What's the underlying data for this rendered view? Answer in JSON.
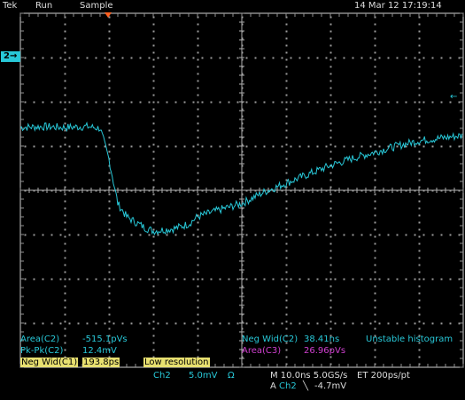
{
  "header": {
    "brand": "Tek",
    "run_state": "Run",
    "acq_mode": "Sample",
    "datetime": "14 Mar 12 17:19:14"
  },
  "channel_marker": "2",
  "ref_arrow": "←",
  "measurements": {
    "left": [
      {
        "label": "Area(C2)",
        "value": "-515.1pVs"
      },
      {
        "label": "Pk-Pk(C2)",
        "value": "12.4mV"
      },
      {
        "label": "Neg Wid(C1)",
        "value": "193.8ps"
      }
    ],
    "low_res": "Low resolution",
    "right": [
      {
        "label": "Neg Wid(C2)",
        "value": "38.41ns",
        "note": "Unstable histogram"
      },
      {
        "label": "Area(C3)",
        "value": "26.96pVs"
      }
    ]
  },
  "status": {
    "channel": "Ch2",
    "volts_div": "5.0mV",
    "coupling": "Ω",
    "timebase": "M 10.0ns 5.0GS/s",
    "equiv": "ET 200ps/pt",
    "trigger_prefix": "A",
    "trigger_channel": "Ch2",
    "trigger_slope": "╲",
    "trigger_level": "-4.7mV"
  },
  "colors": {
    "trace": "#28c8d8",
    "measure_ch2": "#28c8d8",
    "measure_ch3": "#d040d0",
    "highlight": "#e8e070",
    "trigger_marker": "#ff6020"
  },
  "waveform_ch2": {
    "unit": "mV",
    "points_time_ns": [
      -50,
      -45,
      -40,
      -35,
      -32,
      -30,
      -28,
      -26,
      -24,
      -22,
      -20,
      -18,
      -15,
      -12,
      -10,
      -5,
      0,
      5,
      10,
      15,
      20,
      25,
      30,
      35,
      40,
      45,
      50
    ],
    "points_mv": [
      7.1,
      7.2,
      7.1,
      7.2,
      7.0,
      3.5,
      -1.5,
      -3.0,
      -3.6,
      -4.2,
      -4.6,
      -4.5,
      -4.3,
      -3.8,
      -3.0,
      -2.2,
      -1.5,
      -0.2,
      0.8,
      1.8,
      2.8,
      3.6,
      4.3,
      5.0,
      5.6,
      5.9,
      6.2
    ]
  }
}
